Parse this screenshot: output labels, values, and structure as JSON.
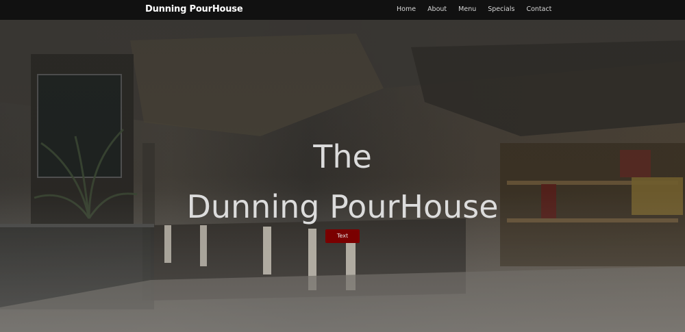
{
  "navbar": {
    "brand": "Dunning PourHouse",
    "links": [
      "Home",
      "About",
      "Menu",
      "Specials",
      "Contact"
    ]
  },
  "hero": {
    "title_line1": "The",
    "title_line2": "Dunning PourHouse",
    "button_label": "Text"
  },
  "colors": {
    "navbar_bg": "#111111",
    "button_bg": "#7a0000",
    "title_color": "#dcdcdc"
  }
}
